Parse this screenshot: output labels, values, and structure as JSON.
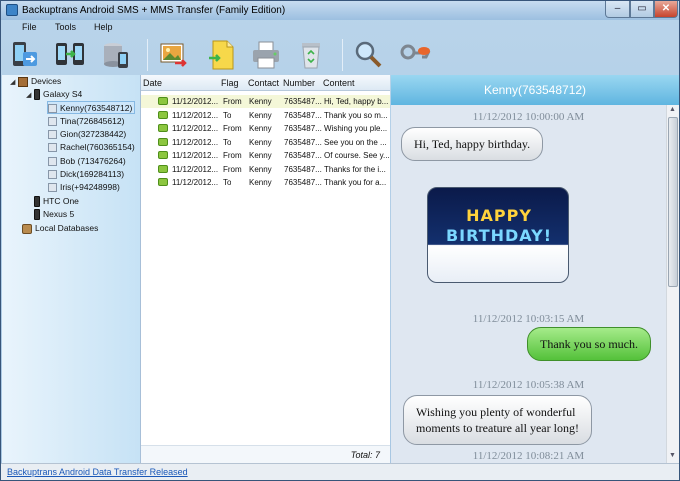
{
  "window": {
    "title": "Backuptrans Android SMS + MMS Transfer (Family Edition)",
    "controls": [
      "–",
      "▭",
      "✕"
    ]
  },
  "menu": [
    "File",
    "Tools",
    "Help"
  ],
  "tree": {
    "devices_label": "Devices",
    "galaxy_label": "Galaxy S4",
    "contacts": [
      "Kenny(763548712)",
      "Tina(726845612)",
      "Gion(327238442)",
      "Rachel(760365154)",
      "Bob (713476264)",
      "Dick(169284113)",
      "Iris(+94248998)"
    ],
    "htc_label": "HTC One",
    "nexus_label": "Nexus 5",
    "local_label": "Local Databases"
  },
  "list": {
    "headers": {
      "date": "Date",
      "flag": "Flag",
      "contact": "Contact",
      "number": "Number",
      "content": "Content"
    },
    "rows": [
      {
        "date": "11/12/2012...",
        "flag": "From",
        "contact": "Kenny",
        "number": "7635487...",
        "content": "Hi, Ted, happy b..."
      },
      {
        "date": "11/12/2012...",
        "flag": "To",
        "contact": "Kenny",
        "number": "7635487...",
        "content": "Thank you so m..."
      },
      {
        "date": "11/12/2012...",
        "flag": "From",
        "contact": "Kenny",
        "number": "7635487...",
        "content": "Wishing you ple..."
      },
      {
        "date": "11/12/2012...",
        "flag": "To",
        "contact": "Kenny",
        "number": "7635487...",
        "content": "See you on the ..."
      },
      {
        "date": "11/12/2012...",
        "flag": "From",
        "contact": "Kenny",
        "number": "7635487...",
        "content": "Of course. See y..."
      },
      {
        "date": "11/12/2012...",
        "flag": "From",
        "contact": "Kenny",
        "number": "7635487...",
        "content": "Thanks for the i..."
      },
      {
        "date": "11/12/2012...",
        "flag": "To",
        "contact": "Kenny",
        "number": "7635487...",
        "content": "Thank you for a..."
      }
    ],
    "total": "Total: 7"
  },
  "conversation": {
    "header": "Kenny(763548712)",
    "ts1": "11/12/2012 10:00:00 AM",
    "msg1": "Hi, Ted, happy birthday.",
    "photo_line1": "HAPPY",
    "photo_line2": "BIRTHDAY!",
    "ts2": "11/12/2012 10:03:15 AM",
    "msg2": "Thank you so much.",
    "ts3": "11/12/2012 10:05:38 AM",
    "msg3_line1": "Wishing you plenty of wonderful",
    "msg3_line2": "moments to treature all year long!",
    "ts4": "11/12/2012 10:08:21 AM"
  },
  "status": {
    "link": "Backuptrans Android Data Transfer Released"
  },
  "colors": {
    "incoming": "#e8ebee",
    "outgoing": "#6fd24c",
    "header": "#6dbde4"
  },
  "icons": [
    "import-icon",
    "transfer-icon",
    "database-icon",
    "photo-export-icon",
    "document-icon",
    "printer-icon",
    "recycle-bin-icon",
    "search-icon",
    "key-icon"
  ]
}
